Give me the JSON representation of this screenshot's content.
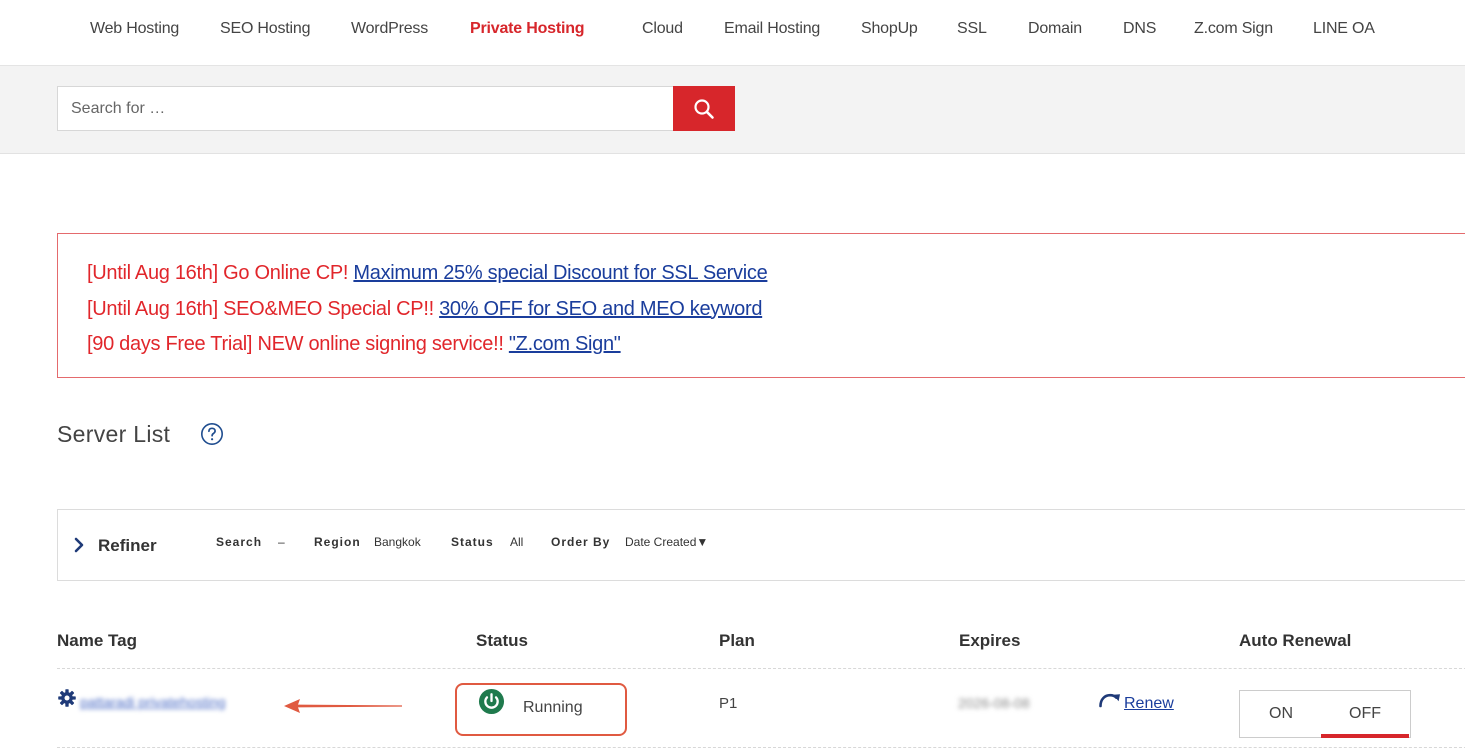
{
  "nav": {
    "items": [
      {
        "label": "Web Hosting"
      },
      {
        "label": "SEO Hosting"
      },
      {
        "label": "WordPress"
      },
      {
        "label": "Private Hosting"
      },
      {
        "label": "Cloud"
      },
      {
        "label": "Email Hosting"
      },
      {
        "label": "ShopUp"
      },
      {
        "label": "SSL"
      },
      {
        "label": "Domain"
      },
      {
        "label": "DNS"
      },
      {
        "label": "Z.com Sign"
      },
      {
        "label": "LINE OA"
      }
    ],
    "active": "Private Hosting"
  },
  "search": {
    "placeholder": "Search for …",
    "button_icon": "search-icon"
  },
  "notices": [
    {
      "prefix": "[Until Aug 16th] Go Online CP! ",
      "link": "Maximum 25% special Discount for SSL Service"
    },
    {
      "prefix": "[Until Aug 16th] SEO&MEO Special CP!! ",
      "link": "30% OFF for SEO and MEO keyword"
    },
    {
      "prefix": "[90 days Free Trial] NEW online signing service!! ",
      "link": "\"Z.com Sign\""
    }
  ],
  "server_list": {
    "title": "Server List",
    "help_icon": "question-circle-icon"
  },
  "refiner": {
    "label": "Refiner",
    "filters": {
      "search_key": "Search",
      "search_value": "–",
      "region_key": "Region",
      "region_value": "Bangkok",
      "status_key": "Status",
      "status_value": "All",
      "order_key": "Order By",
      "order_value": "Date Created▼"
    }
  },
  "table": {
    "headers": {
      "name_tag": "Name Tag",
      "status": "Status",
      "plan": "Plan",
      "expires": "Expires",
      "auto_renewal": "Auto Renewal"
    },
    "rows": [
      {
        "name": "pattaradi privatehosting",
        "status": "Running",
        "plan": "P1",
        "expires": "2026-08-08",
        "renew_label": "Renew",
        "auto_renewal": {
          "on": "ON",
          "off": "OFF",
          "selected": "OFF"
        }
      }
    ]
  },
  "colors": {
    "brand_red": "#d7262b",
    "notice_red": "#e1262b",
    "link_blue": "#1a3d9c",
    "running_green": "#1f7a4d",
    "annotation": "#e05a41"
  }
}
